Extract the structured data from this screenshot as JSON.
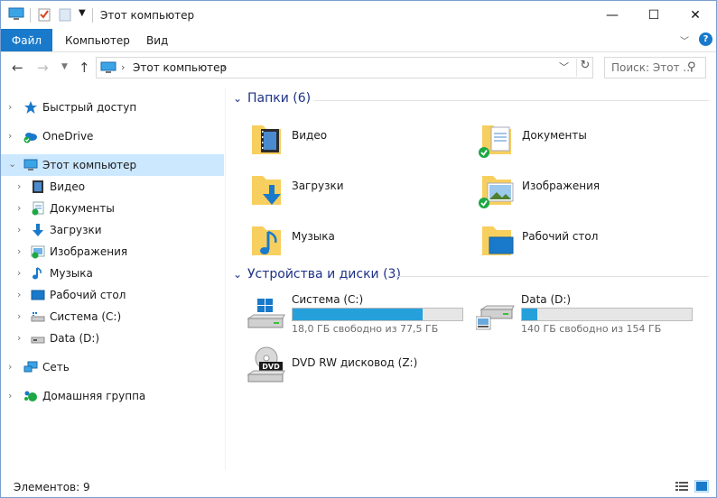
{
  "window": {
    "title": "Этот компьютер",
    "controls": {
      "minimize": "—",
      "maximize": "☐",
      "close": "✕"
    }
  },
  "ribbon": {
    "tabs": [
      {
        "label": "Файл",
        "active": true
      },
      {
        "label": "Компьютер"
      },
      {
        "label": "Вид"
      }
    ],
    "help": "?"
  },
  "address": {
    "path": "Этот компьютер",
    "search_placeholder": "Поиск: Этот ..."
  },
  "sidebar": {
    "items": [
      {
        "label": "Быстрый доступ",
        "icon": "star-icon",
        "level": 0
      },
      {
        "label": "OneDrive",
        "icon": "onedrive-icon",
        "level": 0
      },
      {
        "label": "Этот компьютер",
        "icon": "computer-icon",
        "level": 0,
        "selected": true,
        "expanded": true
      },
      {
        "label": "Видео",
        "icon": "video-folder-icon",
        "level": 1
      },
      {
        "label": "Документы",
        "icon": "documents-folder-icon",
        "level": 1
      },
      {
        "label": "Загрузки",
        "icon": "downloads-folder-icon",
        "level": 1
      },
      {
        "label": "Изображения",
        "icon": "pictures-folder-icon",
        "level": 1
      },
      {
        "label": "Музыка",
        "icon": "music-folder-icon",
        "level": 1
      },
      {
        "label": "Рабочий стол",
        "icon": "desktop-folder-icon",
        "level": 1
      },
      {
        "label": "Система (C:)",
        "icon": "system-drive-icon",
        "level": 1
      },
      {
        "label": "Data (D:)",
        "icon": "data-drive-icon",
        "level": 1
      },
      {
        "label": "Сеть",
        "icon": "network-icon",
        "level": 0
      },
      {
        "label": "Домашняя группа",
        "icon": "homegroup-icon",
        "level": 0
      }
    ]
  },
  "content": {
    "folders_group": "Папки (6)",
    "folders": [
      {
        "label": "Видео",
        "icon": "video-folder-icon"
      },
      {
        "label": "Документы",
        "icon": "documents-folder-icon"
      },
      {
        "label": "Загрузки",
        "icon": "downloads-folder-icon"
      },
      {
        "label": "Изображения",
        "icon": "pictures-folder-icon"
      },
      {
        "label": "Музыка",
        "icon": "music-folder-icon"
      },
      {
        "label": "Рабочий стол",
        "icon": "desktop-folder-icon"
      }
    ],
    "devices_group": "Устройства и диски (3)",
    "drives": [
      {
        "label": "Система (C:)",
        "free_text": "18,0 ГБ свободно из 77,5 ГБ",
        "used_fraction": 0.768
      },
      {
        "label": "Data (D:)",
        "free_text": "140 ГБ свободно из 154 ГБ",
        "used_fraction": 0.091
      },
      {
        "label": "DVD RW дисковод (Z:)",
        "icon": "dvd-drive-icon"
      }
    ],
    "dvd_badge": "DVD"
  },
  "status": {
    "items_count": "Элементов: 9"
  },
  "colors": {
    "accent": "#1979ca",
    "selection": "#cce8ff",
    "group_header": "#1e3287",
    "drive_bar": "#26a0da",
    "folder": "#f7cf5e"
  }
}
